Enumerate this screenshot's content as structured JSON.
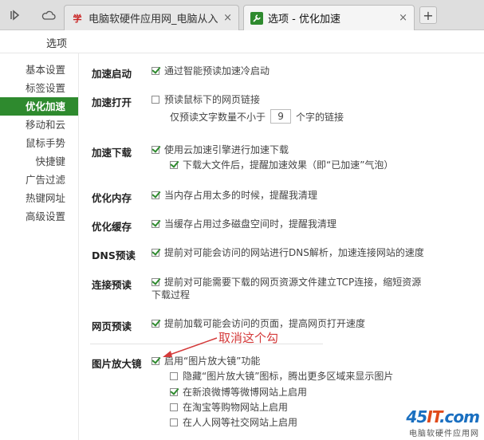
{
  "browser": {
    "tabs": [
      {
        "title": "电脑软硬件应用网_电脑从入门",
        "close": "×"
      },
      {
        "title": "选项 - 优化加速",
        "close": "×"
      }
    ],
    "new_tab": "+"
  },
  "page": {
    "title": "选项"
  },
  "sidebar": {
    "items": [
      {
        "label": "基本设置"
      },
      {
        "label": "标签设置"
      },
      {
        "label": "优化加速"
      },
      {
        "label": "移动和云"
      },
      {
        "label": "鼠标手势"
      },
      {
        "label": "快捷键"
      },
      {
        "label": "广告过滤"
      },
      {
        "label": "热键网址"
      },
      {
        "label": "高级设置"
      }
    ],
    "active_index": 2
  },
  "sections": {
    "startup": {
      "label": "加速启动",
      "option": "通过智能预读加速冷启动"
    },
    "open": {
      "label": "加速打开",
      "option": "预读鼠标下的网页链接",
      "sub_prefix": "仅预读文字数量不小于",
      "sub_value": "9",
      "sub_suffix": "个字的链接"
    },
    "download": {
      "label": "加速下载",
      "option": "使用云加速引擎进行加速下载",
      "sub": "下载大文件后，提醒加速效果（即“已加速”气泡）"
    },
    "memory": {
      "label": "优化内存",
      "option": "当内存占用太多的时候，提醒我清理"
    },
    "cache": {
      "label": "优化缓存",
      "option": "当缓存占用过多磁盘空间时，提醒我清理"
    },
    "dns": {
      "label": "DNS预读",
      "option": "提前对可能会访问的网站进行DNS解析，加速连接网站的速度"
    },
    "connect": {
      "label": "连接预读",
      "option_line1": "提前对可能需要下载的网页资源文件建立TCP连接，缩短资源",
      "option_line2": "下载过程"
    },
    "webpage": {
      "label": "网页预读",
      "option": "提前加载可能会访问的页面，提高网页打开速度"
    },
    "magnifier": {
      "label": "图片放大镜",
      "option": "启用“图片放大镜”功能",
      "subs": [
        "隐藏“图片放大镜”图标，腾出更多区域来显示图片",
        "在新浪微博等微博网站上启用",
        "在淘宝等购物网站上启用",
        "在人人网等社交网站上启用"
      ]
    }
  },
  "annotation": {
    "text": "取消这个勾",
    "color": "#d43a3a"
  },
  "watermark": {
    "logo_a": "45",
    "logo_b": "IT",
    "logo_c": ".com",
    "sub": "电脑软硬件应用网"
  },
  "colors": {
    "accent": "#2e8a2e",
    "annotation": "#d43a3a"
  }
}
